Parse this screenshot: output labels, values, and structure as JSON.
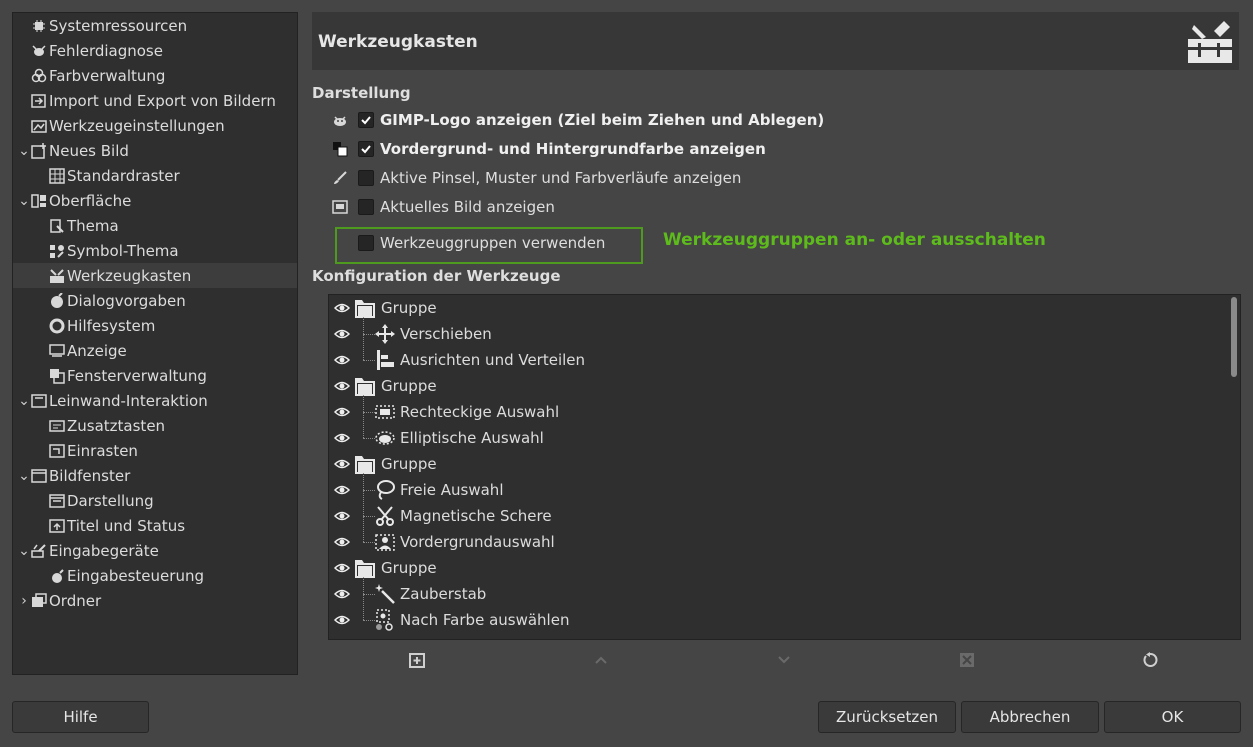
{
  "sidebar": {
    "items": [
      {
        "label": "Systemressourcen",
        "icon": "chip-icon",
        "expander": ""
      },
      {
        "label": "Fehlerdiagnose",
        "icon": "bug-icon",
        "expander": ""
      },
      {
        "label": "Farbverwaltung",
        "icon": "color-circles-icon",
        "expander": ""
      },
      {
        "label": "Import und Export von Bildern",
        "icon": "import-export-icon",
        "expander": ""
      },
      {
        "label": "Werkzeugeinstellungen",
        "icon": "tool-options-icon",
        "expander": ""
      },
      {
        "label": "Neues Bild",
        "icon": "new-image-icon",
        "expander": "⌄"
      },
      {
        "label": "Standardraster",
        "icon": "grid-icon",
        "expander": ""
      },
      {
        "label": "Oberfläche",
        "icon": "interface-icon",
        "expander": "⌄"
      },
      {
        "label": "Thema",
        "icon": "theme-icon",
        "expander": ""
      },
      {
        "label": "Symbol-Thema",
        "icon": "icon-theme-icon",
        "expander": ""
      },
      {
        "label": "Werkzeugkasten",
        "icon": "toolbox-icon",
        "expander": ""
      },
      {
        "label": "Dialogvorgaben",
        "icon": "dialog-defaults-icon",
        "expander": ""
      },
      {
        "label": "Hilfesystem",
        "icon": "help-system-icon",
        "expander": ""
      },
      {
        "label": "Anzeige",
        "icon": "display-icon",
        "expander": ""
      },
      {
        "label": "Fensterverwaltung",
        "icon": "window-management-icon",
        "expander": ""
      },
      {
        "label": "Leinwand-Interaktion",
        "icon": "canvas-interaction-icon",
        "expander": "⌄"
      },
      {
        "label": "Zusatztasten",
        "icon": "modifiers-icon",
        "expander": ""
      },
      {
        "label": "Einrasten",
        "icon": "snapping-icon",
        "expander": ""
      },
      {
        "label": "Bildfenster",
        "icon": "image-window-icon",
        "expander": "⌄"
      },
      {
        "label": "Darstellung",
        "icon": "appearance-icon",
        "expander": ""
      },
      {
        "label": "Titel und Status",
        "icon": "title-status-icon",
        "expander": ""
      },
      {
        "label": "Eingabegeräte",
        "icon": "input-devices-icon",
        "expander": "⌄"
      },
      {
        "label": "Eingabesteuerung",
        "icon": "input-controllers-icon",
        "expander": ""
      },
      {
        "label": "Ordner",
        "icon": "folders-icon",
        "expander": "›"
      }
    ]
  },
  "header": {
    "title": "Werkzeugkasten",
    "icon": "toolbox-icon"
  },
  "darstellung": {
    "title": "Darstellung",
    "options": [
      {
        "label": "GIMP-Logo anzeigen (Ziel beim Ziehen und Ablegen)",
        "checked": true,
        "icon": "wilber-icon"
      },
      {
        "label": "Vordergrund- und Hintergrundfarbe anzeigen",
        "checked": true,
        "icon": "fg-bg-color-icon"
      },
      {
        "label": "Aktive Pinsel, Muster und Farbverläufe anzeigen",
        "checked": false,
        "icon": "brush-icon"
      },
      {
        "label": "Aktuelles Bild anzeigen",
        "checked": false,
        "icon": "image-preview-icon"
      },
      {
        "label": "Werkzeuggruppen verwenden",
        "checked": false,
        "icon": ""
      }
    ]
  },
  "annotation": "Werkzeuggruppen an- oder ausschalten",
  "konfiguration": {
    "title": "Konfiguration der Werkzeuge",
    "rows": [
      {
        "label": "Gruppe",
        "group": true,
        "icon": "folder-icon",
        "last": false
      },
      {
        "label": "Verschieben",
        "group": false,
        "icon": "move-icon",
        "last": false
      },
      {
        "label": "Ausrichten und Verteilen",
        "group": false,
        "icon": "align-icon",
        "last": true
      },
      {
        "label": "Gruppe",
        "group": true,
        "icon": "folder-icon",
        "last": false
      },
      {
        "label": "Rechteckige Auswahl",
        "group": false,
        "icon": "rect-select-icon",
        "last": false
      },
      {
        "label": "Elliptische Auswahl",
        "group": false,
        "icon": "ellipse-select-icon",
        "last": true
      },
      {
        "label": "Gruppe",
        "group": true,
        "icon": "folder-icon",
        "last": false
      },
      {
        "label": "Freie Auswahl",
        "group": false,
        "icon": "lasso-icon",
        "last": false
      },
      {
        "label": "Magnetische Schere",
        "group": false,
        "icon": "scissors-icon",
        "last": false
      },
      {
        "label": "Vordergrundauswahl",
        "group": false,
        "icon": "foreground-select-icon",
        "last": true
      },
      {
        "label": "Gruppe",
        "group": true,
        "icon": "folder-icon",
        "last": false
      },
      {
        "label": "Zauberstab",
        "group": false,
        "icon": "fuzzy-select-icon",
        "last": false
      },
      {
        "label": "Nach Farbe auswählen",
        "group": false,
        "icon": "select-by-color-icon",
        "last": false
      }
    ]
  },
  "toolbar": {
    "new_group": "new-group-icon",
    "up": "chevron-up-icon",
    "down": "chevron-down-icon",
    "delete": "delete-icon",
    "reset": "reset-icon"
  },
  "buttons": {
    "help": "Hilfe",
    "reset": "Zurücksetzen",
    "cancel": "Abbrechen",
    "ok": "OK"
  },
  "colors": {
    "accent_green": "#5dbb1c",
    "highlight_border": "#4d9a1e"
  }
}
